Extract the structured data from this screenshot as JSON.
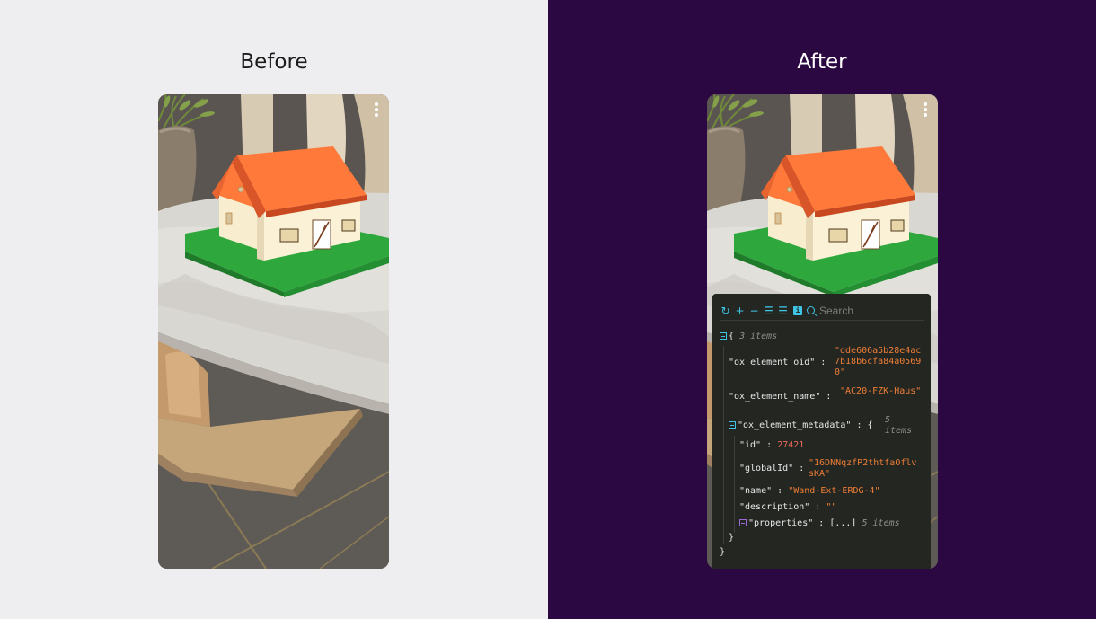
{
  "before": {
    "title": "Before"
  },
  "after": {
    "title": "After"
  },
  "viewer": {
    "search_placeholder": "Search",
    "root_open": "{",
    "root_count": "3 items",
    "rows": {
      "oid_key": "\"ox_element_oid\"",
      "oid_value": "\"dde606a5b28e4ac7b18b6cfa84a05690\"",
      "name_key": "\"ox_element_name\"",
      "name_value": "\"AC20-FZK-Haus\"",
      "meta_key": "\"ox_element_metadata\"",
      "meta_open": "{",
      "meta_count": "5 items",
      "id_key": "\"id\"",
      "id_value": "27421",
      "globalid_key": "\"globalId\"",
      "globalid_value": "\"16DNNqzfP2thtfaOflvsKA\"",
      "elname_key": "\"name\"",
      "elname_value": "\"Wand-Ext-ERDG-4\"",
      "desc_key": "\"description\"",
      "desc_value": "\"\"",
      "props_key": "\"properties\"",
      "props_value": "[...]",
      "props_count": "5 items",
      "meta_close": "}",
      "root_close": "}"
    },
    "separator": ":"
  },
  "colors": {
    "before_bg": "#eeeef1",
    "after_bg": "#2c0843",
    "roof": "#ff7a3a",
    "lawn": "#2ea83c",
    "viewer_bg": "#242622",
    "accent": "#3fc6e6",
    "string": "#ee7e36"
  }
}
